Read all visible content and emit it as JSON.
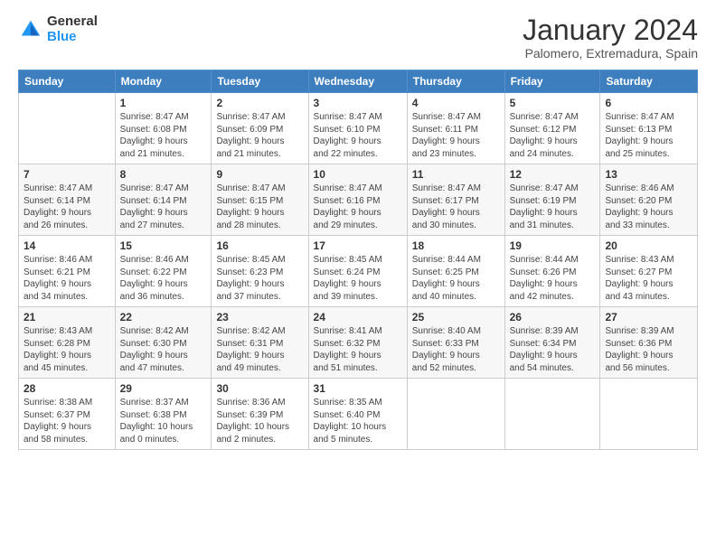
{
  "logo": {
    "general": "General",
    "blue": "Blue"
  },
  "title": "January 2024",
  "subtitle": "Palomero, Extremadura, Spain",
  "header_days": [
    "Sunday",
    "Monday",
    "Tuesday",
    "Wednesday",
    "Thursday",
    "Friday",
    "Saturday"
  ],
  "weeks": [
    [
      {
        "day": "",
        "info": ""
      },
      {
        "day": "1",
        "info": "Sunrise: 8:47 AM\nSunset: 6:08 PM\nDaylight: 9 hours\nand 21 minutes."
      },
      {
        "day": "2",
        "info": "Sunrise: 8:47 AM\nSunset: 6:09 PM\nDaylight: 9 hours\nand 21 minutes."
      },
      {
        "day": "3",
        "info": "Sunrise: 8:47 AM\nSunset: 6:10 PM\nDaylight: 9 hours\nand 22 minutes."
      },
      {
        "day": "4",
        "info": "Sunrise: 8:47 AM\nSunset: 6:11 PM\nDaylight: 9 hours\nand 23 minutes."
      },
      {
        "day": "5",
        "info": "Sunrise: 8:47 AM\nSunset: 6:12 PM\nDaylight: 9 hours\nand 24 minutes."
      },
      {
        "day": "6",
        "info": "Sunrise: 8:47 AM\nSunset: 6:13 PM\nDaylight: 9 hours\nand 25 minutes."
      }
    ],
    [
      {
        "day": "7",
        "info": "Sunrise: 8:47 AM\nSunset: 6:14 PM\nDaylight: 9 hours\nand 26 minutes."
      },
      {
        "day": "8",
        "info": "Sunrise: 8:47 AM\nSunset: 6:14 PM\nDaylight: 9 hours\nand 27 minutes."
      },
      {
        "day": "9",
        "info": "Sunrise: 8:47 AM\nSunset: 6:15 PM\nDaylight: 9 hours\nand 28 minutes."
      },
      {
        "day": "10",
        "info": "Sunrise: 8:47 AM\nSunset: 6:16 PM\nDaylight: 9 hours\nand 29 minutes."
      },
      {
        "day": "11",
        "info": "Sunrise: 8:47 AM\nSunset: 6:17 PM\nDaylight: 9 hours\nand 30 minutes."
      },
      {
        "day": "12",
        "info": "Sunrise: 8:47 AM\nSunset: 6:19 PM\nDaylight: 9 hours\nand 31 minutes."
      },
      {
        "day": "13",
        "info": "Sunrise: 8:46 AM\nSunset: 6:20 PM\nDaylight: 9 hours\nand 33 minutes."
      }
    ],
    [
      {
        "day": "14",
        "info": "Sunrise: 8:46 AM\nSunset: 6:21 PM\nDaylight: 9 hours\nand 34 minutes."
      },
      {
        "day": "15",
        "info": "Sunrise: 8:46 AM\nSunset: 6:22 PM\nDaylight: 9 hours\nand 36 minutes."
      },
      {
        "day": "16",
        "info": "Sunrise: 8:45 AM\nSunset: 6:23 PM\nDaylight: 9 hours\nand 37 minutes."
      },
      {
        "day": "17",
        "info": "Sunrise: 8:45 AM\nSunset: 6:24 PM\nDaylight: 9 hours\nand 39 minutes."
      },
      {
        "day": "18",
        "info": "Sunrise: 8:44 AM\nSunset: 6:25 PM\nDaylight: 9 hours\nand 40 minutes."
      },
      {
        "day": "19",
        "info": "Sunrise: 8:44 AM\nSunset: 6:26 PM\nDaylight: 9 hours\nand 42 minutes."
      },
      {
        "day": "20",
        "info": "Sunrise: 8:43 AM\nSunset: 6:27 PM\nDaylight: 9 hours\nand 43 minutes."
      }
    ],
    [
      {
        "day": "21",
        "info": "Sunrise: 8:43 AM\nSunset: 6:28 PM\nDaylight: 9 hours\nand 45 minutes."
      },
      {
        "day": "22",
        "info": "Sunrise: 8:42 AM\nSunset: 6:30 PM\nDaylight: 9 hours\nand 47 minutes."
      },
      {
        "day": "23",
        "info": "Sunrise: 8:42 AM\nSunset: 6:31 PM\nDaylight: 9 hours\nand 49 minutes."
      },
      {
        "day": "24",
        "info": "Sunrise: 8:41 AM\nSunset: 6:32 PM\nDaylight: 9 hours\nand 51 minutes."
      },
      {
        "day": "25",
        "info": "Sunrise: 8:40 AM\nSunset: 6:33 PM\nDaylight: 9 hours\nand 52 minutes."
      },
      {
        "day": "26",
        "info": "Sunrise: 8:39 AM\nSunset: 6:34 PM\nDaylight: 9 hours\nand 54 minutes."
      },
      {
        "day": "27",
        "info": "Sunrise: 8:39 AM\nSunset: 6:36 PM\nDaylight: 9 hours\nand 56 minutes."
      }
    ],
    [
      {
        "day": "28",
        "info": "Sunrise: 8:38 AM\nSunset: 6:37 PM\nDaylight: 9 hours\nand 58 minutes."
      },
      {
        "day": "29",
        "info": "Sunrise: 8:37 AM\nSunset: 6:38 PM\nDaylight: 10 hours\nand 0 minutes."
      },
      {
        "day": "30",
        "info": "Sunrise: 8:36 AM\nSunset: 6:39 PM\nDaylight: 10 hours\nand 2 minutes."
      },
      {
        "day": "31",
        "info": "Sunrise: 8:35 AM\nSunset: 6:40 PM\nDaylight: 10 hours\nand 5 minutes."
      },
      {
        "day": "",
        "info": ""
      },
      {
        "day": "",
        "info": ""
      },
      {
        "day": "",
        "info": ""
      }
    ]
  ]
}
